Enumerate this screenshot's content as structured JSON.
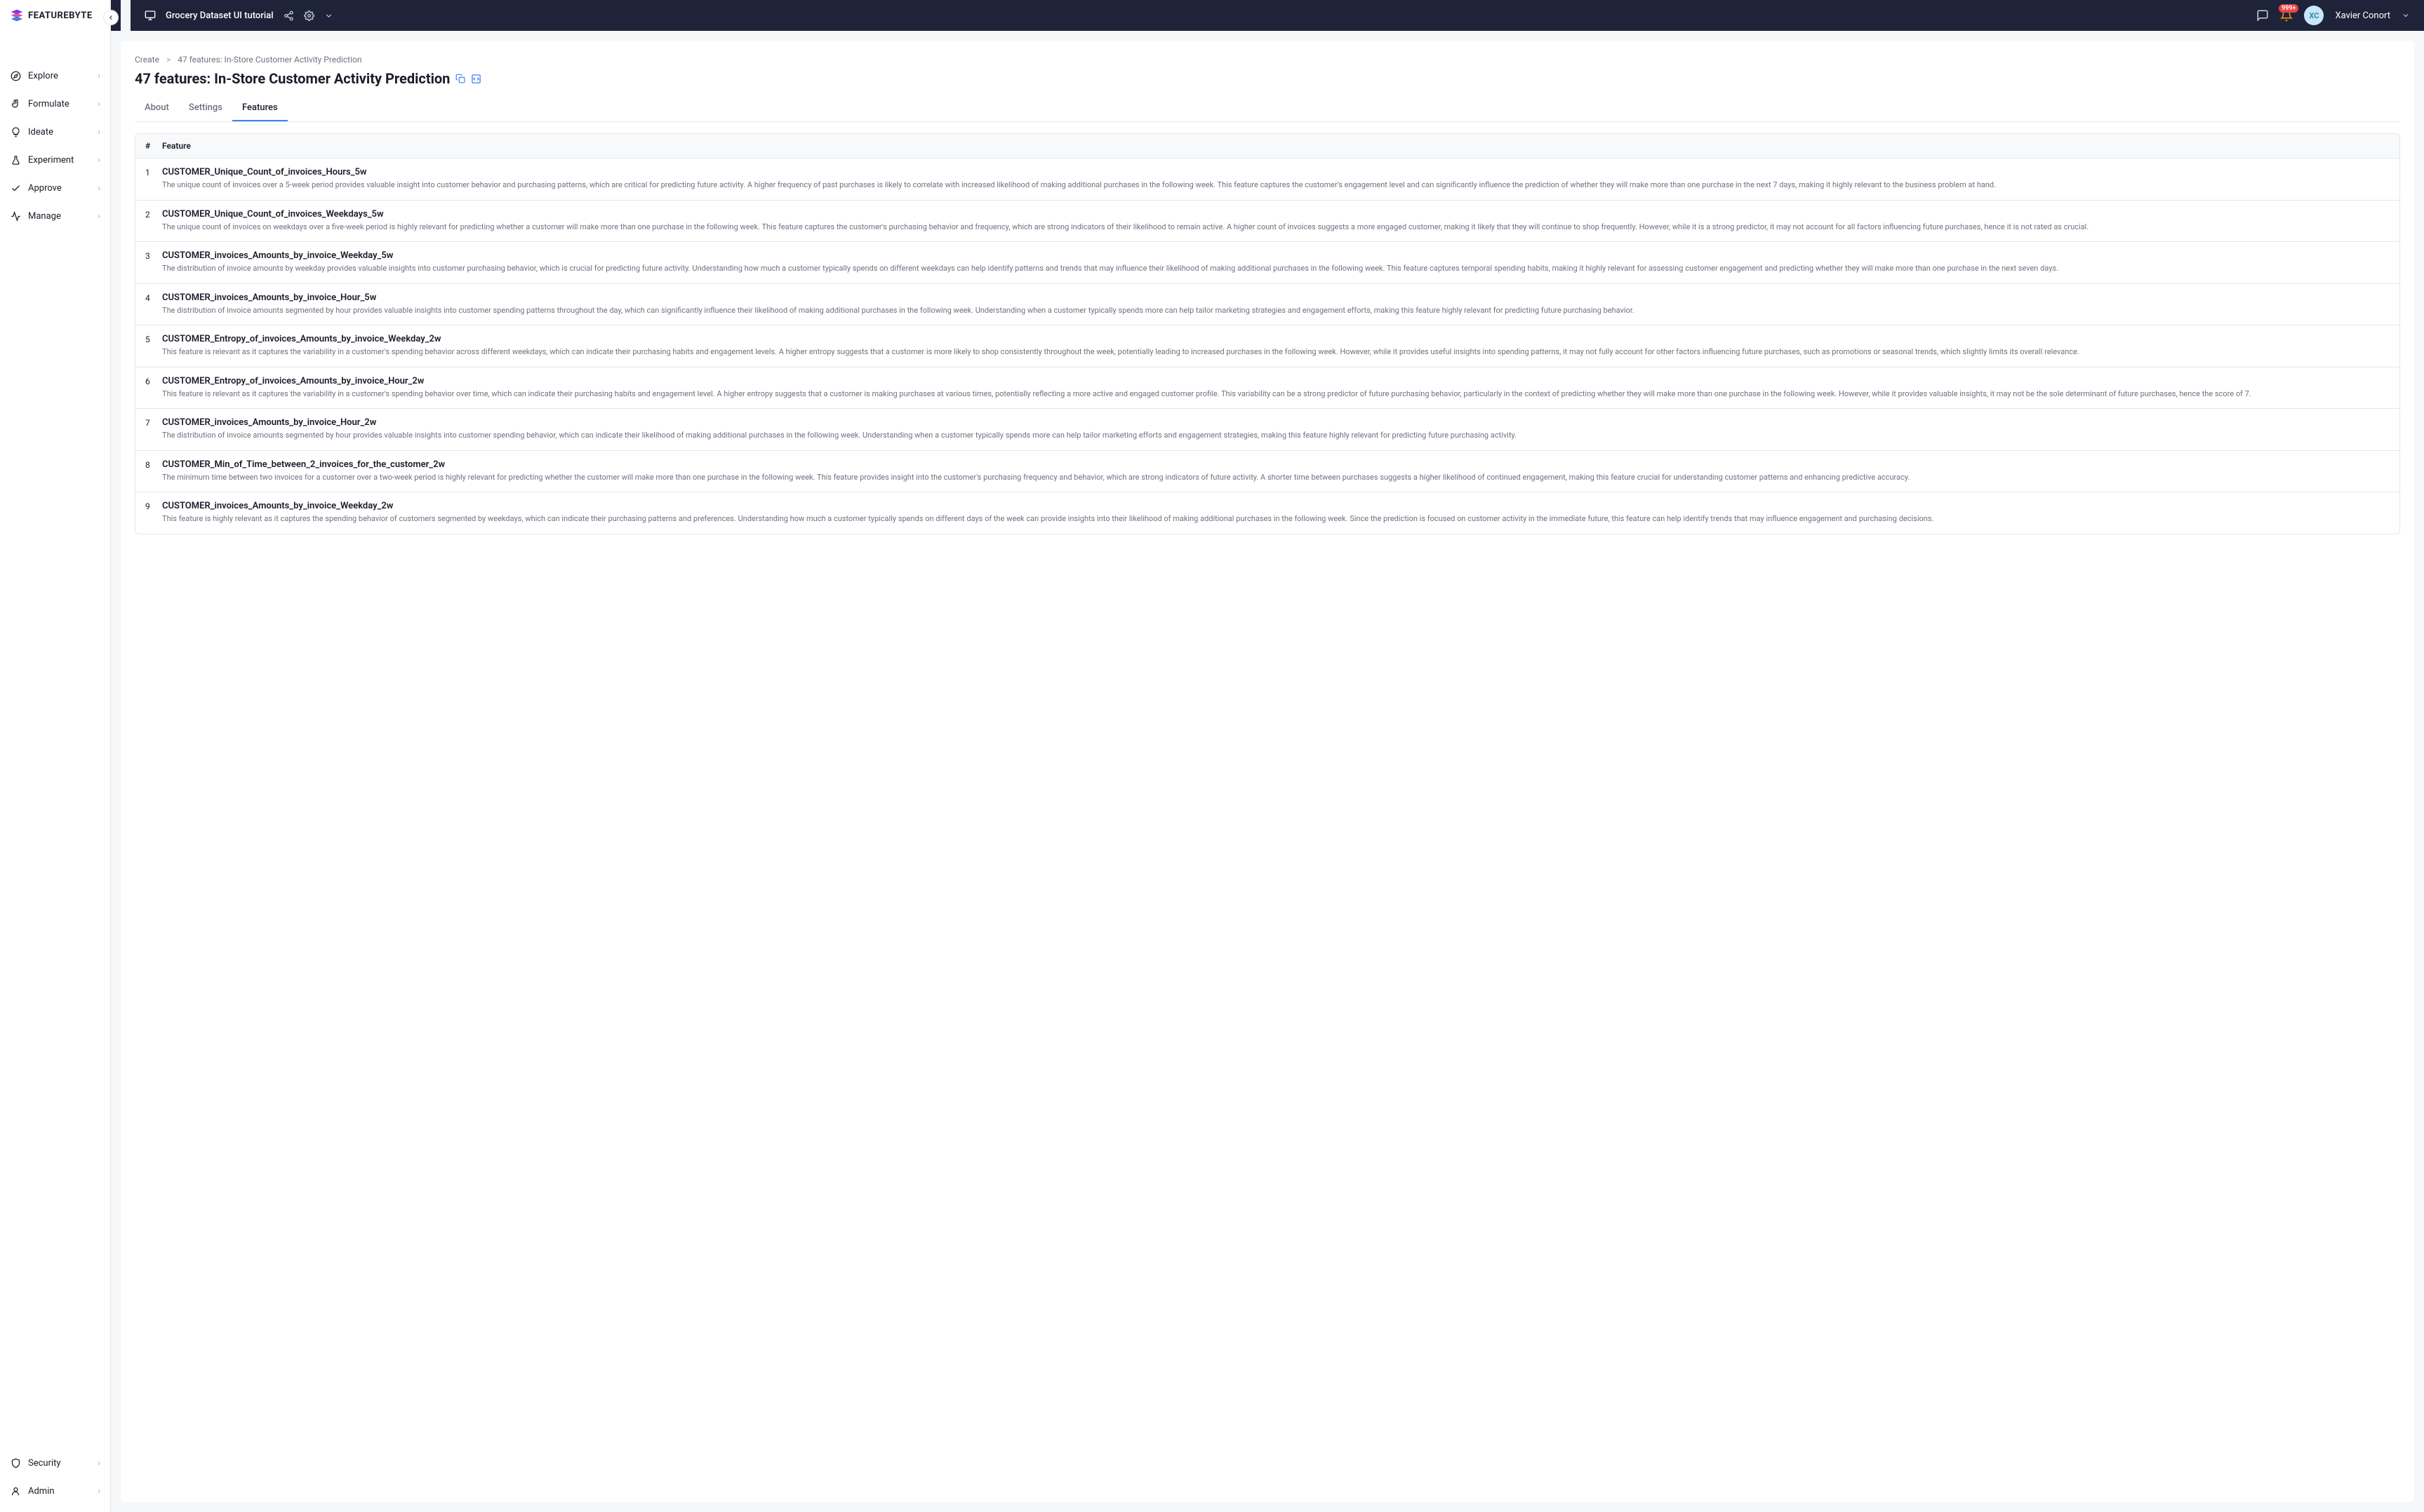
{
  "brand": {
    "text": "FEATUREBYTE"
  },
  "sidebar": {
    "items": [
      {
        "label": "Explore"
      },
      {
        "label": "Formulate"
      },
      {
        "label": "Ideate"
      },
      {
        "label": "Experiment"
      },
      {
        "label": "Approve"
      },
      {
        "label": "Manage"
      }
    ],
    "bottom": [
      {
        "label": "Security"
      },
      {
        "label": "Admin"
      }
    ]
  },
  "topbar": {
    "project_name": "Grocery Dataset UI tutorial",
    "notif_badge": "999+",
    "avatar_initials": "XC",
    "user_name": "Xavier Conort"
  },
  "breadcrumb": {
    "root": "Create",
    "sep": ">",
    "current": "47 features: In-Store Customer Activity Prediction"
  },
  "page_title": "47 features: In-Store Customer Activity Prediction",
  "tabs": [
    {
      "label": "About",
      "active": false
    },
    {
      "label": "Settings",
      "active": false
    },
    {
      "label": "Features",
      "active": true
    }
  ],
  "table": {
    "header_num": "#",
    "header_feature": "Feature",
    "rows": [
      {
        "num": "1",
        "name": "CUSTOMER_Unique_Count_of_invoices_Hours_5w",
        "desc": "The unique count of invoices over a 5-week period provides valuable insight into customer behavior and purchasing patterns, which are critical for predicting future activity. A higher frequency of past purchases is likely to correlate with increased likelihood of making additional purchases in the following week. This feature captures the customer's engagement level and can significantly influence the prediction of whether they will make more than one purchase in the next 7 days, making it highly relevant to the business problem at hand."
      },
      {
        "num": "2",
        "name": "CUSTOMER_Unique_Count_of_invoices_Weekdays_5w",
        "desc": "The unique count of invoices on weekdays over a five-week period is highly relevant for predicting whether a customer will make more than one purchase in the following week. This feature captures the customer's purchasing behavior and frequency, which are strong indicators of their likelihood to remain active. A higher count of invoices suggests a more engaged customer, making it likely that they will continue to shop frequently. However, while it is a strong predictor, it may not account for all factors influencing future purchases, hence it is not rated as crucial."
      },
      {
        "num": "3",
        "name": "CUSTOMER_invoices_Amounts_by_invoice_Weekday_5w",
        "desc": "The distribution of invoice amounts by weekday provides valuable insights into customer purchasing behavior, which is crucial for predicting future activity. Understanding how much a customer typically spends on different weekdays can help identify patterns and trends that may influence their likelihood of making additional purchases in the following week. This feature captures temporal spending habits, making it highly relevant for assessing customer engagement and predicting whether they will make more than one purchase in the next seven days."
      },
      {
        "num": "4",
        "name": "CUSTOMER_invoices_Amounts_by_invoice_Hour_5w",
        "desc": "The distribution of invoice amounts segmented by hour provides valuable insights into customer spending patterns throughout the day, which can significantly influence their likelihood of making additional purchases in the following week. Understanding when a customer typically spends more can help tailor marketing strategies and engagement efforts, making this feature highly relevant for predicting future purchasing behavior."
      },
      {
        "num": "5",
        "name": "CUSTOMER_Entropy_of_invoices_Amounts_by_invoice_Weekday_2w",
        "desc": "This feature is relevant as it captures the variability in a customer's spending behavior across different weekdays, which can indicate their purchasing habits and engagement levels. A higher entropy suggests that a customer is more likely to shop consistently throughout the week, potentially leading to increased purchases in the following week. However, while it provides useful insights into spending patterns, it may not fully account for other factors influencing future purchases, such as promotions or seasonal trends, which slightly limits its overall relevance."
      },
      {
        "num": "6",
        "name": "CUSTOMER_Entropy_of_invoices_Amounts_by_invoice_Hour_2w",
        "desc": "This feature is relevant as it captures the variability in a customer's spending behavior over time, which can indicate their purchasing habits and engagement level. A higher entropy suggests that a customer is making purchases at various times, potentially reflecting a more active and engaged customer profile. This variability can be a strong predictor of future purchasing behavior, particularly in the context of predicting whether they will make more than one purchase in the following week. However, while it provides valuable insights, it may not be the sole determinant of future purchases, hence the score of 7."
      },
      {
        "num": "7",
        "name": "CUSTOMER_invoices_Amounts_by_invoice_Hour_2w",
        "desc": "The distribution of invoice amounts segmented by hour provides valuable insights into customer spending behavior, which can indicate their likelihood of making additional purchases in the following week. Understanding when a customer typically spends more can help tailor marketing efforts and engagement strategies, making this feature highly relevant for predicting future purchasing activity."
      },
      {
        "num": "8",
        "name": "CUSTOMER_Min_of_Time_between_2_invoices_for_the_customer_2w",
        "desc": "The minimum time between two invoices for a customer over a two-week period is highly relevant for predicting whether the customer will make more than one purchase in the following week. This feature provides insight into the customer's purchasing frequency and behavior, which are strong indicators of future activity. A shorter time between purchases suggests a higher likelihood of continued engagement, making this feature crucial for understanding customer patterns and enhancing predictive accuracy."
      },
      {
        "num": "9",
        "name": "CUSTOMER_invoices_Amounts_by_invoice_Weekday_2w",
        "desc": "This feature is highly relevant as it captures the spending behavior of customers segmented by weekdays, which can indicate their purchasing patterns and preferences. Understanding how much a customer typically spends on different days of the week can provide insights into their likelihood of making additional purchases in the following week. Since the prediction is focused on customer activity in the immediate future, this feature can help identify trends that may influence engagement and purchasing decisions."
      }
    ]
  }
}
